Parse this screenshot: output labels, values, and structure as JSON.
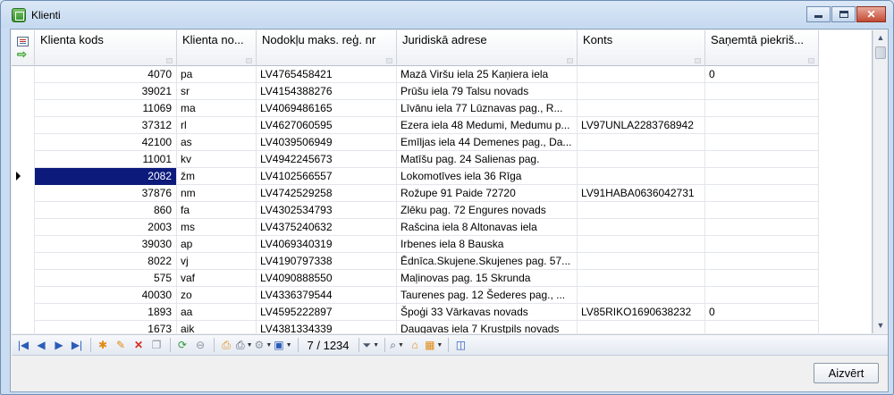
{
  "window": {
    "title": "Klienti",
    "close_button": "✕"
  },
  "grid": {
    "columns": [
      {
        "label": "Klienta kods",
        "width": 159
      },
      {
        "label": "Klienta no...",
        "width": 89
      },
      {
        "label": "Nodokļu maks. reģ. nr",
        "width": 157
      },
      {
        "label": "Juridiskā adrese",
        "width": 202
      },
      {
        "label": "Konts",
        "width": 143
      },
      {
        "label": "Saņemtā piekriš...",
        "width": 127
      }
    ],
    "current_row": 6,
    "rows": [
      [
        "4070",
        "pa",
        "LV4765458421",
        "Mazā Viršu iela 25 Kaņiera iela",
        "",
        "0"
      ],
      [
        "39021",
        "sr",
        "LV4154388276",
        "Prūšu iela 79 Talsu novads",
        "",
        ""
      ],
      [
        "11069",
        "ma",
        "LV4069486165",
        "Līvānu iela  77  Lūznavas pag., R...",
        "",
        ""
      ],
      [
        "37312",
        "rl",
        "LV4627060595",
        "Ezera iela 48 Medumi, Medumu p...",
        "LV97UNLA2283768942",
        ""
      ],
      [
        "42100",
        "as",
        "LV4039506949",
        "Emīljas iela 44 Demenes pag., Da...",
        "",
        ""
      ],
      [
        "11001",
        "kv",
        "LV4942245673",
        "Matīšu pag. 24 Salienas pag.",
        "",
        ""
      ],
      [
        "2082",
        "žm",
        "LV4102566557",
        "Lokomotīves iela 36 Rīga",
        "",
        ""
      ],
      [
        "37876",
        "nm",
        "LV4742529258",
        "Rožupe 91 Paide 72720",
        "LV91HABA0636042731",
        ""
      ],
      [
        "860",
        "fa",
        "LV4302534793",
        "Zlēku pag. 72 Engures novads",
        "",
        ""
      ],
      [
        "2003",
        "ms",
        "LV4375240632",
        "Rašcina iela 8 Altonavas iela",
        "",
        ""
      ],
      [
        "39030",
        "ap",
        "LV4069340319",
        "Irbenes iela 8 Bauska",
        "",
        ""
      ],
      [
        "8022",
        "vj",
        "LV4190797338",
        "Ēdnīca.Skujene.Skujenes pag. 57...",
        "",
        ""
      ],
      [
        "575",
        "vaf",
        "LV4090888550",
        "Maļinovas pag. 15 Skrunda",
        "",
        ""
      ],
      [
        "40030",
        "zo",
        "LV4336379544",
        "Taurenes pag. 12 Šederes pag., ...",
        "",
        ""
      ],
      [
        "1893",
        "aa",
        "LV4595222897",
        "Špoģi 33 Vārkavas novads",
        "LV85RIKO1690638232",
        "0"
      ],
      [
        "1673",
        "aik",
        "LV4381334339",
        "Daugavas iela 7 Krustpils novads",
        "",
        ""
      ]
    ]
  },
  "navigator": {
    "counter": "7 / 1234",
    "buttons": [
      {
        "name": "first-record-icon",
        "glyph": "|◀",
        "color": "blue"
      },
      {
        "name": "prev-record-icon",
        "glyph": "◀",
        "color": "blue"
      },
      {
        "name": "next-record-icon",
        "glyph": "▶",
        "color": "blue"
      },
      {
        "name": "last-record-icon",
        "glyph": "▶|",
        "color": "blue"
      },
      {
        "name": "sep"
      },
      {
        "name": "add-record-icon",
        "glyph": "✱",
        "color": "orange"
      },
      {
        "name": "edit-record-icon",
        "glyph": "✎",
        "color": "orange"
      },
      {
        "name": "delete-record-icon",
        "glyph": "✕",
        "color": "red"
      },
      {
        "name": "copy-record-icon",
        "glyph": "❐",
        "color": "grey"
      },
      {
        "name": "sep"
      },
      {
        "name": "refresh-icon",
        "glyph": "⟳",
        "color": "green"
      },
      {
        "name": "cancel-icon",
        "glyph": "⊖",
        "color": "grey"
      },
      {
        "name": "sep"
      },
      {
        "name": "print-preview-icon",
        "glyph": "⎙",
        "color": "orange"
      },
      {
        "name": "print-icon",
        "glyph": "⎙",
        "color": "dark",
        "dropdown": true
      },
      {
        "name": "settings-icon",
        "glyph": "⚙",
        "color": "grey",
        "dropdown": true
      },
      {
        "name": "export-icon",
        "glyph": "▣",
        "color": "blue",
        "dropdown": true
      },
      {
        "name": "sep"
      },
      {
        "name": "counter"
      },
      {
        "name": "sep"
      },
      {
        "name": "filter-icon",
        "glyph": "⏷",
        "color": "dark",
        "dropdown": true
      },
      {
        "name": "sep"
      },
      {
        "name": "find-icon",
        "glyph": "⌕",
        "color": "dark",
        "dropdown": true
      },
      {
        "name": "home-icon",
        "glyph": "⌂",
        "color": "orange"
      },
      {
        "name": "columns-icon",
        "glyph": "▦",
        "color": "orange",
        "dropdown": true
      },
      {
        "name": "sep"
      },
      {
        "name": "help-icon",
        "glyph": "◫",
        "color": "blue"
      }
    ]
  },
  "footer": {
    "close_label": "Aizvērt"
  }
}
